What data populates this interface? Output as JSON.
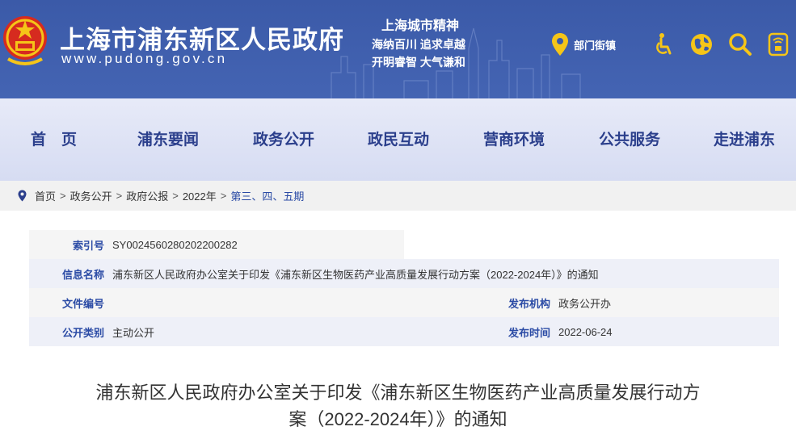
{
  "header": {
    "site_title": "上海市浦东新区人民政府",
    "site_url": "www.pudong.gov.cn",
    "spirit_title": "上海城市精神",
    "spirit_line1": "海纳百川  追求卓越",
    "spirit_line2": "开明睿智  大气谦和",
    "dept_label": "部门街镇",
    "icons": [
      "location-pin-icon",
      "accessibility-icon",
      "globe-icon",
      "search-icon",
      "mobile-icon"
    ]
  },
  "nav": {
    "items": [
      "首　页",
      "浦东要闻",
      "政务公开",
      "政民互动",
      "营商环境",
      "公共服务",
      "走进浦东"
    ]
  },
  "breadcrumb": {
    "items": [
      "首页",
      "政务公开",
      "政府公报",
      "2022年",
      "第三、四、五期"
    ],
    "separator": ">"
  },
  "info": {
    "index_label": "索引号",
    "index_value": "SY0024560280202200282",
    "name_label": "信息名称",
    "name_value": "浦东新区人民政府办公室关于印发《浦东新区生物医药产业高质量发展行动方案（2022-2024年）》的通知",
    "docno_label": "文件编号",
    "docno_value": "",
    "org_label": "发布机构",
    "org_value": "政务公开办",
    "category_label": "公开类别",
    "category_value": "主动公开",
    "date_label": "发布时间",
    "date_value": "2022-06-24"
  },
  "article": {
    "title_line1": "浦东新区人民政府办公室关于印发《浦东新区生物医药产业高质量发展行动方",
    "title_line2": "案（2022-2024年）》的通知"
  },
  "colors": {
    "header_bg": "#3b5aa8",
    "nav_text": "#2b3f8c",
    "accent_yellow": "#f5c518",
    "label_blue": "#2b4ba5"
  }
}
